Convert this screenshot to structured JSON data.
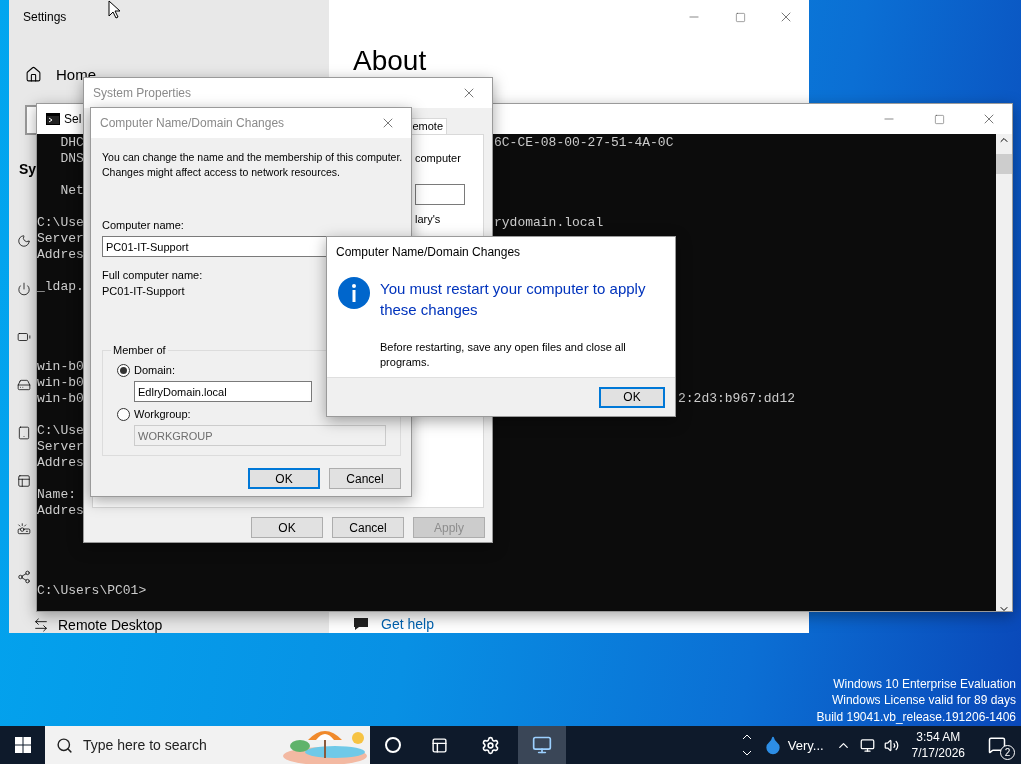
{
  "settings": {
    "title": "Settings",
    "home": "Home",
    "section": "Sy",
    "nav_items": [
      {
        "label": "Remote Desktop"
      }
    ],
    "page_title": "About",
    "help_link": "Get help"
  },
  "console": {
    "title": "Sel",
    "lines": [
      {
        "text": "   DHC",
        "right": "6C-CE-08-00-27-51-4A-0C"
      },
      {
        "text": "   DNS"
      },
      {
        "text": "   Net"
      },
      {
        "text": "C:\\Use",
        "right": "rydomain.local"
      },
      {
        "text": "Server"
      },
      {
        "text": "Addres"
      },
      {
        "text": "_ldap."
      },
      {
        "text": "win-b0"
      },
      {
        "text": "win-b0"
      },
      {
        "text": "win-b0",
        "far": "2:2d3:b967:dd12"
      },
      {
        "text": "C:\\Use"
      },
      {
        "text": "Server"
      },
      {
        "text": "Addres"
      },
      {
        "text": "Name:"
      },
      {
        "text": "Addres"
      },
      {
        "text": "C:\\Users\\PC01>"
      }
    ]
  },
  "system_properties": {
    "title": "System Properties",
    "tabs": [
      {
        "label": "emote",
        "selected": true
      }
    ],
    "panel_texts": [
      "computer",
      "lary's"
    ],
    "buttons": [
      {
        "label": "OK",
        "disabled": false,
        "focused": false
      },
      {
        "label": "Cancel",
        "disabled": false,
        "focused": false
      },
      {
        "label": "Apply",
        "disabled": true,
        "focused": false
      }
    ]
  },
  "name_dialog": {
    "title": "Computer Name/Domain Changes",
    "intro": "You can change the name and the membership of this computer. Changes might affect access to network resources.",
    "name_label": "Computer name:",
    "name_value": "PC01-IT-Support",
    "full_label": "Full computer name:",
    "full_value": "PC01-IT-Support",
    "group_label": "Member of",
    "options": [
      {
        "label": "Domain:",
        "selected": true,
        "value": "EdlryDomain.local"
      },
      {
        "label": "Workgroup:",
        "selected": false,
        "value": "WORKGROUP"
      }
    ],
    "buttons": [
      {
        "label": "OK",
        "disabled": false,
        "focused": true
      },
      {
        "label": "Cancel",
        "disabled": false,
        "focused": false
      }
    ]
  },
  "message": {
    "title": "Computer Name/Domain Changes",
    "heading": "You must restart your computer to apply these changes",
    "body": "Before restarting, save any open files and close all programs.",
    "buttons": [
      {
        "label": "OK",
        "disabled": false,
        "focused": true
      }
    ]
  },
  "desktop": {
    "notice": [
      "Windows 10 Enterprise Evaluation",
      "Windows License valid for 89 days",
      "Build 19041.vb_release.191206-1406"
    ]
  },
  "taskbar": {
    "search_placeholder": "Type here to search",
    "widget": "Very...",
    "time": "3:54 AM",
    "date": "7/17/2026",
    "notifications": "2"
  }
}
